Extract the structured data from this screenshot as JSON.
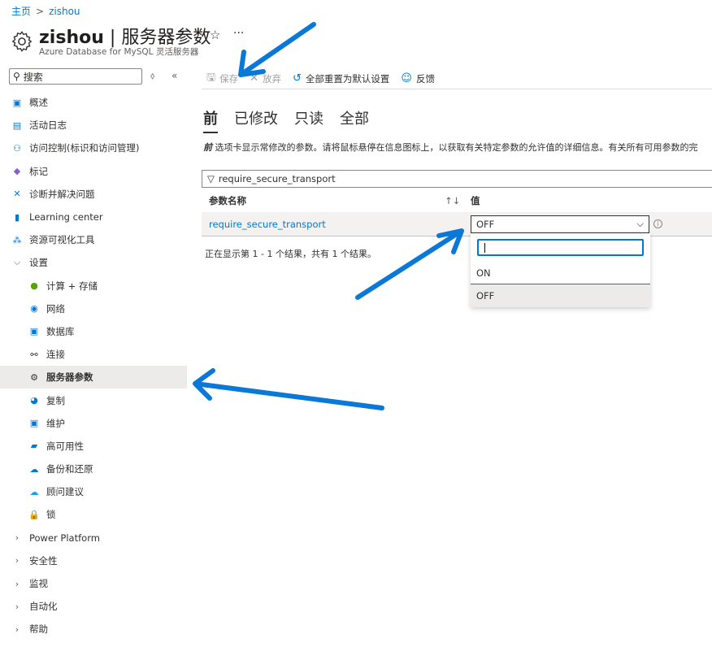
{
  "breadcrumb": {
    "home": "主页",
    "current": "zishou"
  },
  "header": {
    "resource": "zishou",
    "page": "服务器参数",
    "subtitle": "Azure Database for MySQL 灵活服务器",
    "separator": "|"
  },
  "search": {
    "placeholder": "搜索"
  },
  "sidebar": {
    "items": [
      {
        "label": "概述",
        "icon": "mysql-icon",
        "color": "#0078d4"
      },
      {
        "label": "活动日志",
        "icon": "activity-log-icon",
        "color": "#0078d4"
      },
      {
        "label": "访问控制(标识和访问管理)",
        "icon": "access-control-icon",
        "color": "#0078d4"
      },
      {
        "label": "标记",
        "icon": "tag-icon",
        "color": "#8661c5"
      },
      {
        "label": "诊断并解决问题",
        "icon": "diagnose-icon",
        "color": "#0078d4"
      },
      {
        "label": "Learning center",
        "icon": "learning-center-icon",
        "color": "#0078d4"
      },
      {
        "label": "资源可视化工具",
        "icon": "resource-visualizer-icon",
        "color": "#0078d4"
      }
    ],
    "settings": {
      "label": "设置",
      "items": [
        {
          "label": "计算 + 存储",
          "icon": "compute-storage-icon",
          "color": "#57a300"
        },
        {
          "label": "网络",
          "icon": "network-icon",
          "color": "#0078d4"
        },
        {
          "label": "数据库",
          "icon": "database-icon",
          "color": "#0078d4"
        },
        {
          "label": "连接",
          "icon": "connect-icon",
          "color": "#323130"
        },
        {
          "label": "服务器参数",
          "icon": "gear-icon",
          "color": "#323130",
          "selected": true
        },
        {
          "label": "复制",
          "icon": "replication-icon",
          "color": "#0078d4"
        },
        {
          "label": "维护",
          "icon": "maintenance-icon",
          "color": "#0078d4"
        },
        {
          "label": "高可用性",
          "icon": "high-availability-icon",
          "color": "#0078d4"
        },
        {
          "label": "备份和还原",
          "icon": "backup-restore-icon",
          "color": "#0078d4"
        },
        {
          "label": "顾问建议",
          "icon": "advisor-icon",
          "color": "#1ba1e2"
        },
        {
          "label": "锁",
          "icon": "lock-icon",
          "color": "#0078d4"
        }
      ]
    },
    "groups": [
      "Power Platform",
      "安全性",
      "监视",
      "自动化",
      "帮助"
    ]
  },
  "toolbar": {
    "save": "保存",
    "discard": "放弃",
    "reset": "全部重置为默认设置",
    "feedback": "反馈"
  },
  "tabs": [
    "前",
    "已修改",
    "只读",
    "全部"
  ],
  "description": {
    "bold": "前",
    "text": " 选项卡显示常修改的参数。请将鼠标悬停在信息图标上，以获取有关特定参数的允许值的详细信息。有关所有可用参数的完"
  },
  "filter": {
    "value": "require_secure_transport"
  },
  "table": {
    "columns": [
      "参数名称",
      "值"
    ],
    "rows": [
      {
        "name": "require_secure_transport",
        "value": "OFF"
      }
    ]
  },
  "count": "正在显示第 1 - 1 个结果，共有 1 个结果。",
  "dropdown": {
    "search_value": "",
    "options": [
      "ON",
      "OFF"
    ],
    "selected": "OFF"
  },
  "annotation_color": "#0a78d7"
}
